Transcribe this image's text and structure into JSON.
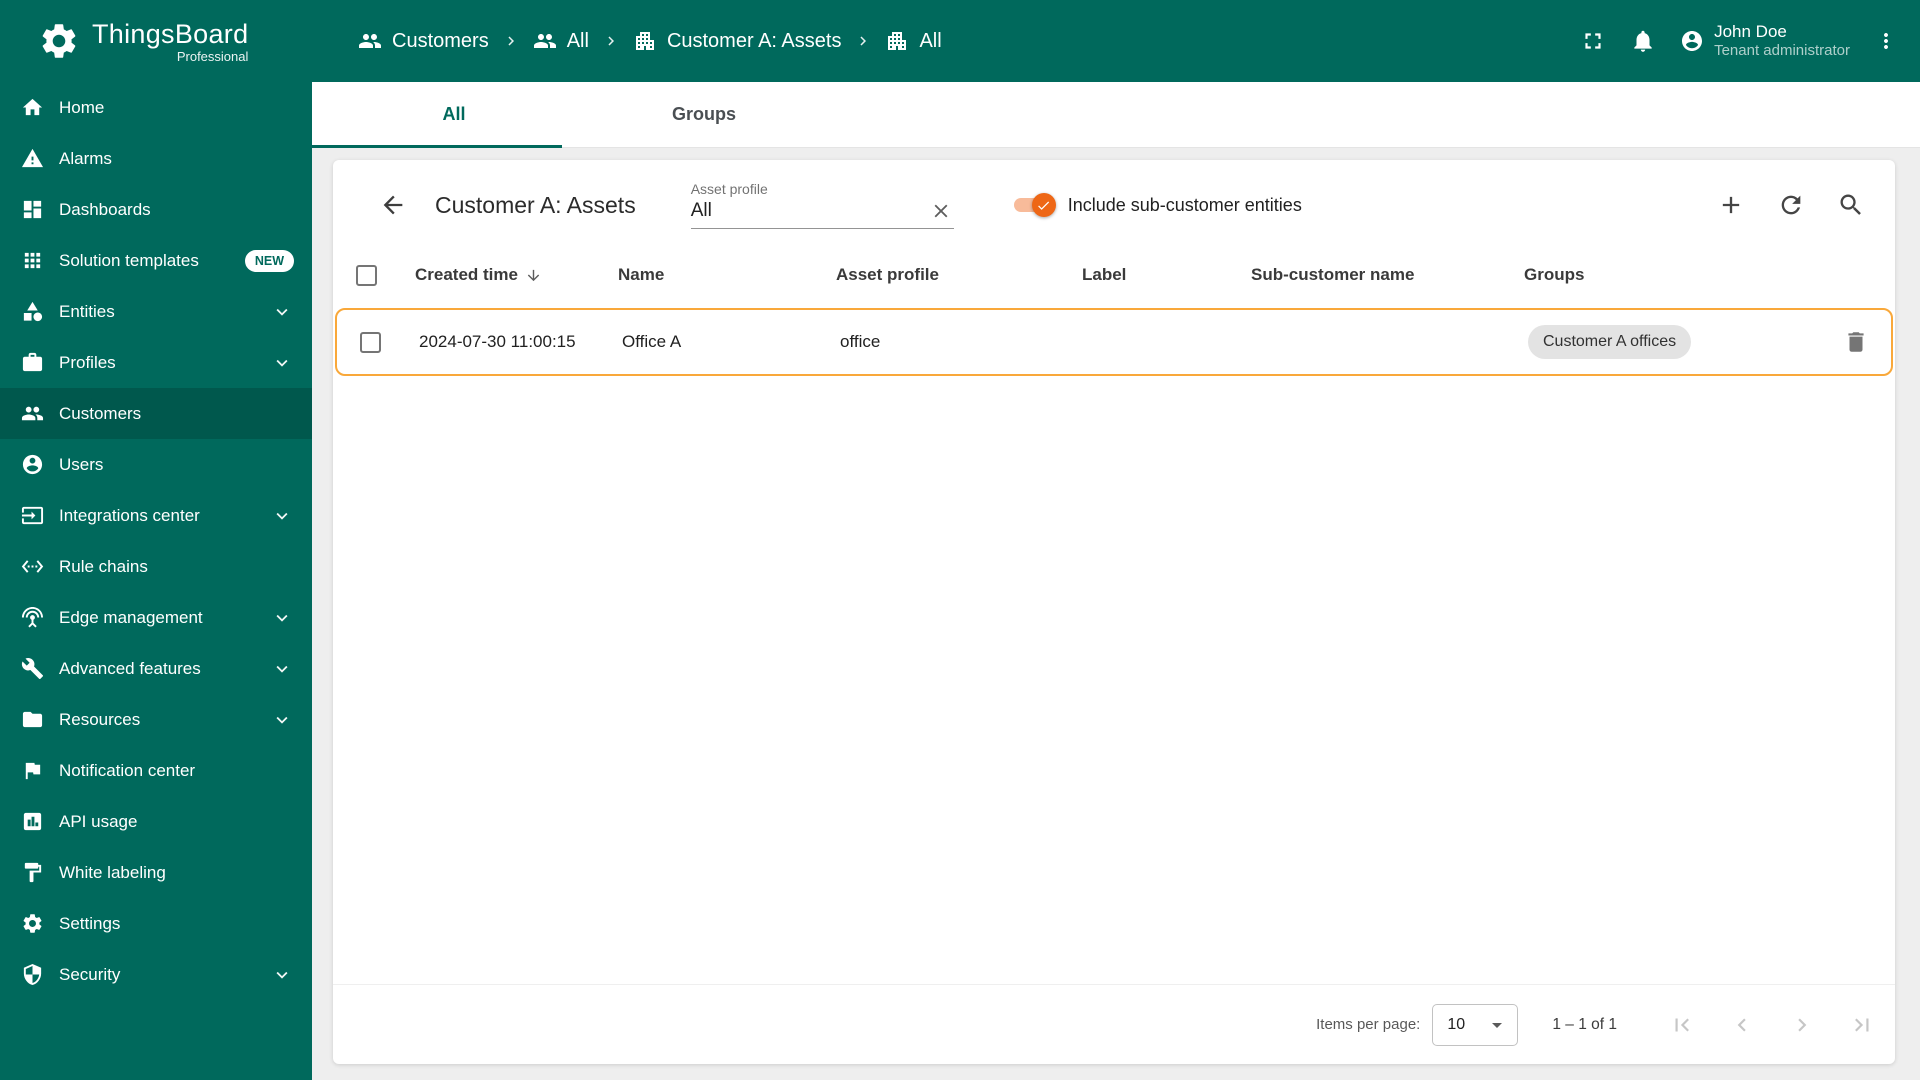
{
  "colors": {
    "primary": "#00695c",
    "accent_orange": "#ee6716",
    "row_highlight_border": "#f9a83a",
    "chip_bg": "#e3e3e3"
  },
  "brand": {
    "name": "ThingsBoard",
    "subtitle": "Professional"
  },
  "sidebar": {
    "items": [
      {
        "label": "Home"
      },
      {
        "label": "Alarms"
      },
      {
        "label": "Dashboards"
      },
      {
        "label": "Solution templates",
        "badge": "NEW"
      },
      {
        "label": "Entities"
      },
      {
        "label": "Profiles"
      },
      {
        "label": "Customers"
      },
      {
        "label": "Users"
      },
      {
        "label": "Integrations center"
      },
      {
        "label": "Rule chains"
      },
      {
        "label": "Edge management"
      },
      {
        "label": "Advanced features"
      },
      {
        "label": "Resources"
      },
      {
        "label": "Notification center"
      },
      {
        "label": "API usage"
      },
      {
        "label": "White labeling"
      },
      {
        "label": "Settings"
      },
      {
        "label": "Security"
      }
    ]
  },
  "header": {
    "breadcrumb": [
      {
        "label": "Customers"
      },
      {
        "label": "All"
      },
      {
        "label": "Customer A: Assets"
      },
      {
        "label": "All"
      }
    ],
    "user": {
      "name": "John Doe",
      "role": "Tenant administrator"
    }
  },
  "tabs": [
    {
      "label": "All"
    },
    {
      "label": "Groups"
    }
  ],
  "toolbar": {
    "title": "Customer A: Assets",
    "filter_label": "Asset profile",
    "filter_value": "All",
    "toggle_label": "Include sub-customer entities"
  },
  "table": {
    "columns": [
      "Created time",
      "Name",
      "Asset profile",
      "Label",
      "Sub-customer name",
      "Groups"
    ],
    "rows": [
      {
        "created_time": "2024-07-30 11:00:15",
        "name": "Office A",
        "asset_profile": "office",
        "label": "",
        "sub_customer_name": "",
        "groups": [
          "Customer A offices"
        ]
      }
    ]
  },
  "pagination": {
    "items_per_page_label": "Items per page:",
    "page_size": "10",
    "range": "1 – 1 of 1"
  }
}
